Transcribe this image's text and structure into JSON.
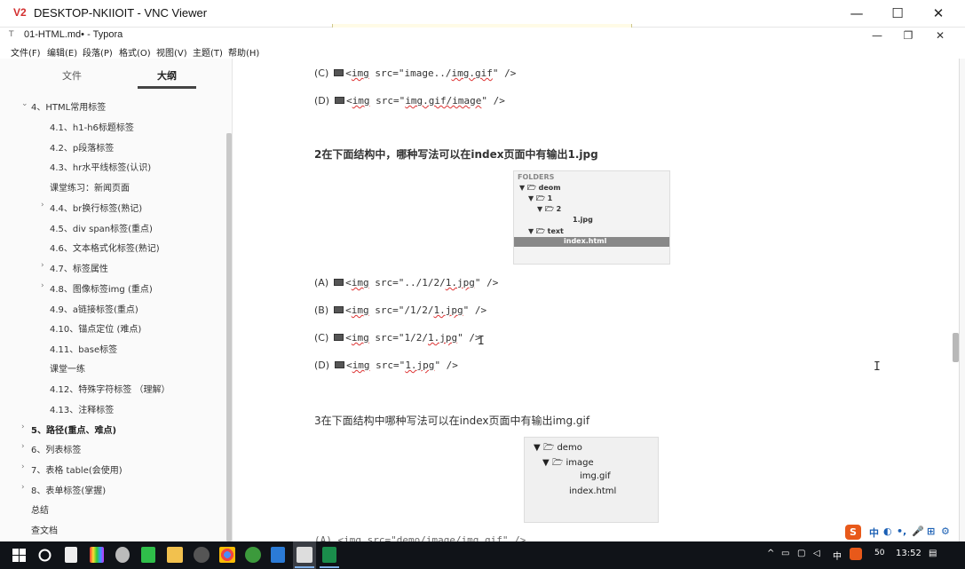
{
  "vnc": {
    "logo": "V2",
    "title": "DESKTOP-NKIIOIT - VNC Viewer",
    "minimize": "—",
    "maximize": "☐",
    "close": "✕"
  },
  "typora": {
    "icon": "T",
    "title": "01-HTML.md• - Typora",
    "minimize": "—",
    "restore": "❐",
    "close": "✕"
  },
  "menu": [
    "文件(F)",
    "编辑(E)",
    "段落(P)",
    "格式(O)",
    "视图(V)",
    "主题(T)",
    "帮助(H)"
  ],
  "sidebar": {
    "tabs": {
      "files": "文件",
      "outline": "大纲"
    },
    "items": [
      {
        "label": "4、HTML常用标签",
        "chevron": "⌄"
      },
      {
        "label": "4.1、h1-h6标题标签"
      },
      {
        "label": "4.2、p段落标签"
      },
      {
        "label": "4.3、hr水平线标签(认识)"
      },
      {
        "label": "课堂练习：新闻页面"
      },
      {
        "label": "4.4、br换行标签(熟记)",
        "chevron": "›"
      },
      {
        "label": "4.5、div span标签(重点)"
      },
      {
        "label": "4.6、文本格式化标签(熟记)"
      },
      {
        "label": "4.7、标签属性",
        "chevron": "›"
      },
      {
        "label": "4.8、图像标签img (重点)",
        "chevron": "›"
      },
      {
        "label": "4.9、a链接标签(重点)"
      },
      {
        "label": "4.10、锚点定位 (难点)"
      },
      {
        "label": "4.11、base标签"
      },
      {
        "label": "课堂一练"
      },
      {
        "label": "4.12、特殊字符标签 （理解）"
      },
      {
        "label": "4.13、注释标签"
      },
      {
        "label": "5、路径(重点、难点)",
        "chevron": "›"
      },
      {
        "label": "6、列表标签",
        "chevron": "›"
      },
      {
        "label": "7、表格 table(会使用)",
        "chevron": "›"
      },
      {
        "label": "8、表单标签(掌握)",
        "chevron": "›"
      },
      {
        "label": "总结"
      },
      {
        "label": "查文档"
      }
    ],
    "bottom_left": "<",
    "bottom_code": "</>"
  },
  "content": {
    "q1_opts": [
      {
        "label": "(C)",
        "pre": "<",
        "tag": "img",
        "attr": " src=\"image../",
        "file": "img.gif",
        "post": "\" />"
      },
      {
        "label": "(D)",
        "pre": "<",
        "tag": "img",
        "attr": " src=\"",
        "file": "img.gif/image",
        "post": "\" />"
      }
    ],
    "q2_title": "2在下面结构中，哪种写法可以在index页面中有输出1.jpg",
    "q2_folders": {
      "header": "FOLDERS",
      "items": [
        "▼ 🗁 deom",
        "▼ 🗁 1",
        "▼ 🗁 2",
        "1.jpg",
        "▼ 🗁 text",
        "index.html"
      ]
    },
    "q2_opts": [
      {
        "label": "(A)",
        "pre": "<",
        "tag": "img",
        "attr": " src=\"../1/2/",
        "file": "1.jpg",
        "post": "\" />"
      },
      {
        "label": "(B)",
        "pre": "<",
        "tag": "img",
        "attr": " src=\"/1/2/",
        "file": "1.jpg",
        "post": "\" />"
      },
      {
        "label": "(C)",
        "pre": "<",
        "tag": "img",
        "attr": " src=\"1/2/",
        "file": "1.jpg",
        "post": "\" />"
      },
      {
        "label": "(D)",
        "pre": "<",
        "tag": "img",
        "attr": " src=\"",
        "file": "1.jpg",
        "post": "\" />"
      }
    ],
    "q3_title": "3在下面结构中哪种写法可以在index页面中有输出img.gif",
    "q3_tree": [
      "▼ 🗁 demo",
      "▼ 🗁 image",
      "img.gif",
      "index.html"
    ],
    "q3_partial": "(A) <img src=\"demo/image/img.gif\" />"
  },
  "ime": {
    "logo": "S",
    "items": [
      "中",
      "◐",
      "•,",
      "🎤",
      "⊞",
      "⚙"
    ]
  },
  "taskbar": {
    "tray": {
      "lang": "中",
      "time": "13:52",
      "battery": "50"
    }
  }
}
